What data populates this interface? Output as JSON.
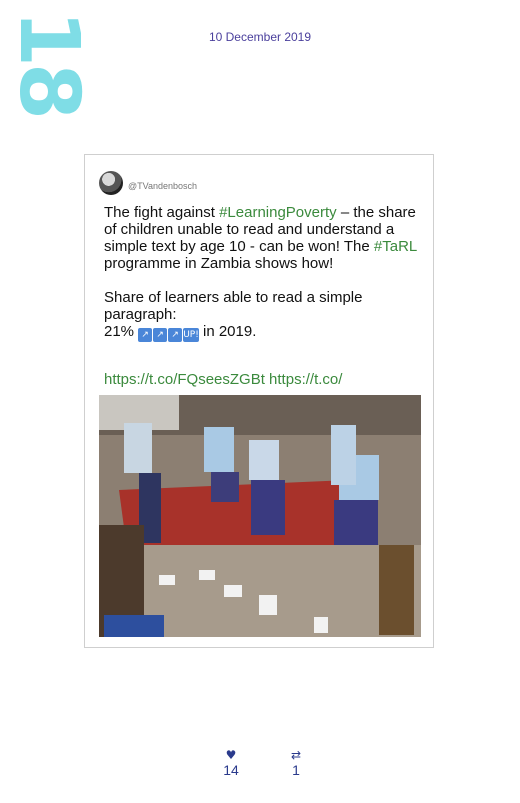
{
  "page": {
    "number": "18"
  },
  "header": {
    "date": "10 December 2019"
  },
  "tweet": {
    "handle": "@TVandenbosch",
    "text": {
      "p1_a": "The fight against ",
      "p1_tag1": "#LearningPoverty",
      "p1_b": " – the share of children unable to read and understand a simple text by age 10 - can be won! The ",
      "p1_tag2": "#TaRL",
      "p1_c": " programme in Zambia shows how!",
      "p2_a": "Share of learners able to read a simple paragraph:",
      "p2_b": "21% ",
      "emoji": [
        "↗",
        "↗",
        "↗",
        "UP!"
      ],
      "p2_c": " in 2019."
    },
    "links": "https://t.co/FQseesZGBt https://t.co/"
  },
  "stats": {
    "likes": {
      "icon": "heart-icon",
      "count": "14"
    },
    "retweets": {
      "icon": "retweet-icon",
      "count": "1"
    }
  }
}
